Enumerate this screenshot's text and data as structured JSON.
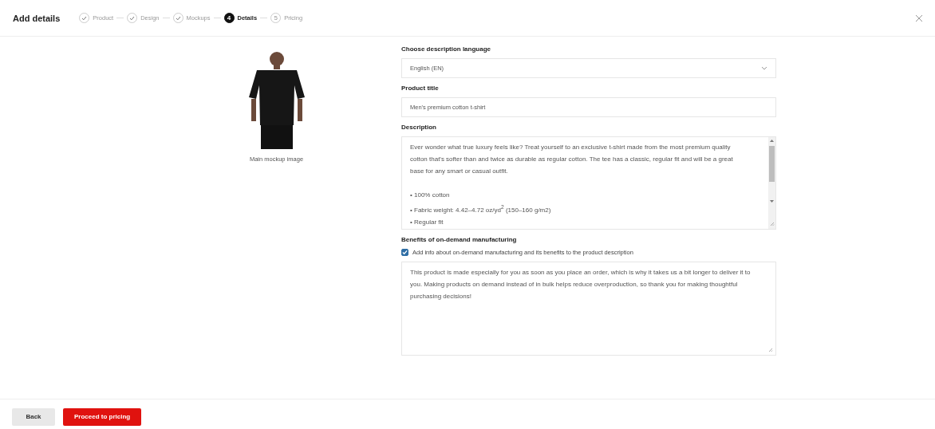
{
  "header": {
    "title": "Add details",
    "steps": [
      {
        "label": "Product",
        "kind": "done"
      },
      {
        "label": "Design",
        "kind": "done"
      },
      {
        "label": "Mockups",
        "kind": "done"
      },
      {
        "label": "Details",
        "kind": "current",
        "number": "4"
      },
      {
        "label": "Pricing",
        "kind": "upcoming",
        "number": "5"
      }
    ]
  },
  "mockup": {
    "caption": "Main mockup image"
  },
  "language": {
    "label": "Choose description language",
    "value": "English (EN)"
  },
  "product_title": {
    "label": "Product title",
    "value": "Men's premium cotton t-shirt"
  },
  "description": {
    "label": "Description",
    "paragraph": "Ever wonder what true luxury feels like? Treat yourself to an exclusive t-shirt made from the most premium quality cotton that's softer than and twice as durable as regular cotton. The tee has a classic, regular fit and will be a great base for any smart or casual outfit.",
    "bullets": [
      "• 100% cotton",
      "• Fabric weight: 4.42–4.72 oz/yd$^{2}$  (150–160 g/m2)",
      "• Regular fit"
    ]
  },
  "benefits": {
    "label": "Benefits of on-demand manufacturing",
    "checkbox": {
      "label": "Add info about on-demand manufacturing and its benefits to the product description",
      "checked": true
    },
    "text": "This product is made especially for you as soon as you place an order, which is why it takes us a bit longer to deliver it to you. Making products on demand instead of in bulk helps reduce overproduction, so thank you for making thoughtful purchasing decisions!"
  },
  "footer": {
    "back": "Back",
    "proceed": "Proceed to pricing"
  }
}
